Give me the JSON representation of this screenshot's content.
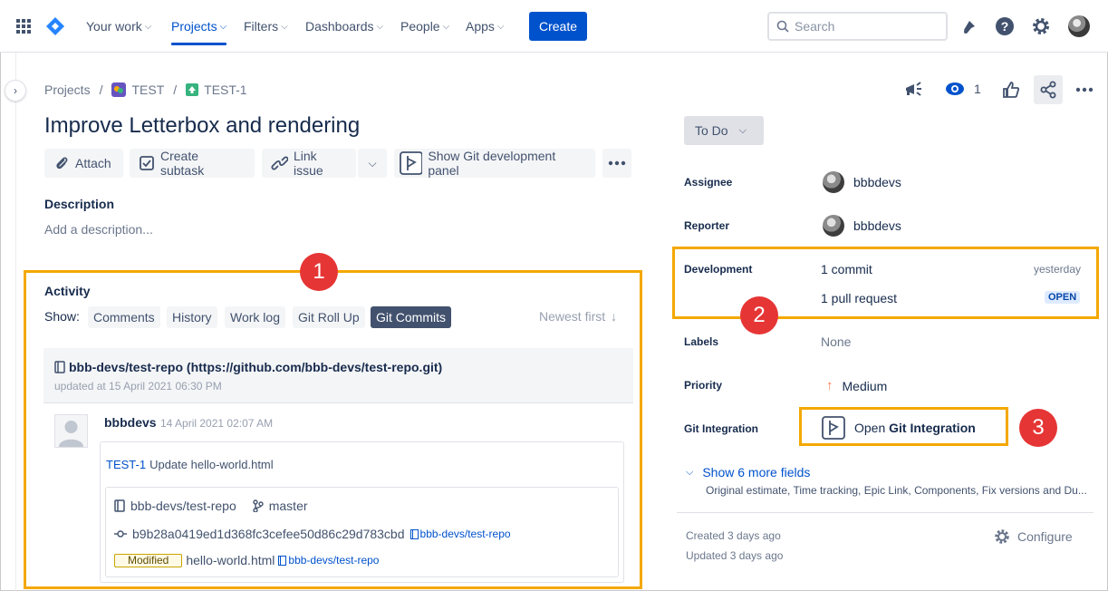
{
  "nav": {
    "items": [
      {
        "label": "Your work"
      },
      {
        "label": "Projects"
      },
      {
        "label": "Filters"
      },
      {
        "label": "Dashboards"
      },
      {
        "label": "People"
      },
      {
        "label": "Apps"
      }
    ],
    "create_label": "Create",
    "search_placeholder": "Search",
    "accent": "#0052cc"
  },
  "breadcrumb": {
    "projects": "Projects",
    "sep1": "/",
    "project": "TEST",
    "sep2": "/",
    "issue": "TEST-1"
  },
  "issue": {
    "title": "Improve Letterbox and rendering",
    "actions": {
      "attach": "Attach",
      "create_subtask": "Create subtask",
      "link_issue": "Link issue",
      "git_panel": "Show Git development panel"
    },
    "description_label": "Description",
    "description_placeholder": "Add a description..."
  },
  "watchers": {
    "count": "1"
  },
  "activity": {
    "heading": "Activity",
    "show_label": "Show:",
    "filters": [
      "Comments",
      "History",
      "Work log",
      "Git Roll Up",
      "Git Commits"
    ],
    "selected_filter": "Git Commits",
    "sort": "Newest first",
    "repo": {
      "name": "bbb-devs/test-repo (https://github.com/bbb-devs/test-repo.git)",
      "updated": "updated at 15 April 2021 06:30 PM"
    },
    "commit": {
      "author": "bbbdevs",
      "date": "14 April 2021 02:07 AM",
      "issue_key": "TEST-1",
      "message": "Update hello-world.html",
      "repo": "bbb-devs/test-repo",
      "branch": "master",
      "hash": "b9b28a0419ed1d368fc3cefee50d86c29d783cbd",
      "hash_repo_link": "bbb-devs/test-repo",
      "change_type": "Modified",
      "file": "hello-world.html",
      "file_repo_link": "bbb-devs/test-repo"
    }
  },
  "sidebar": {
    "status": "To Do",
    "assignee_label": "Assignee",
    "assignee": "bbbdevs",
    "reporter_label": "Reporter",
    "reporter": "bbbdevs",
    "development_label": "Development",
    "commits": "1 commit",
    "commits_time": "yesterday",
    "pull_requests": "1 pull request",
    "pr_status": "OPEN",
    "labels_label": "Labels",
    "labels_value": "None",
    "priority_label": "Priority",
    "priority_value": "Medium",
    "git_label": "Git Integration",
    "git_open_prefix": "Open",
    "git_open_bold": "Git Integration",
    "more_fields": "Show 6 more fields",
    "more_fields_sub": "Original estimate, Time tracking, Epic Link, Components, Fix versions and Du...",
    "created": "Created 3 days ago",
    "updated": "Updated 3 days ago",
    "configure": "Configure"
  },
  "callouts": [
    "1",
    "2",
    "3"
  ],
  "colors": {
    "highlight": "#f4a800",
    "callout": "#e63535"
  }
}
